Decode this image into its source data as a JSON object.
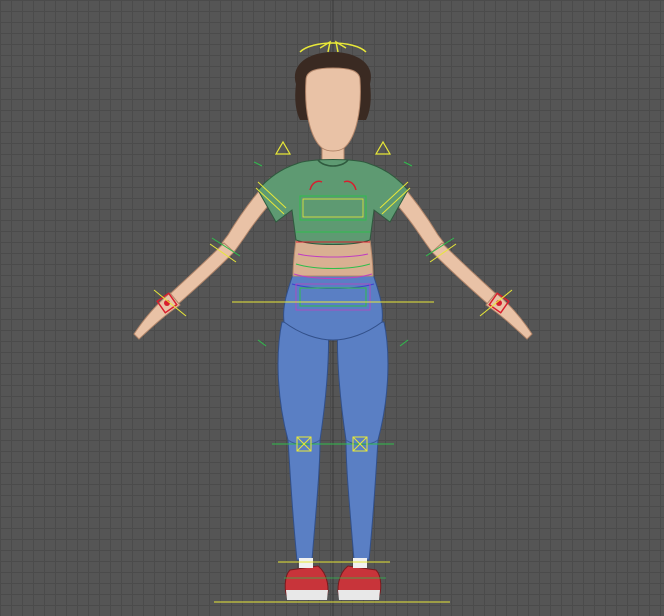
{
  "viewport": {
    "kind": "3d-modeling-viewport",
    "view": "front-orthographic"
  },
  "character": {
    "pose": "A-pose",
    "colors": {
      "skin": "#e9c2a6",
      "skin_shade": "#c9987a",
      "hair": "#3a2a22",
      "shirt": "#5e9a72",
      "shirt_shade": "#3f7354",
      "pants": "#5a7fc4",
      "pants_shade": "#3d5c99",
      "shoes": "#c8343a",
      "shoe_sole": "#e8e8e8"
    }
  },
  "rig": {
    "colors": {
      "yellow": "#e8e838",
      "green": "#2fbd4c",
      "red": "#d81e2e",
      "magenta": "#c040c0",
      "blue": "#4040d0",
      "center_axis": "#3a3a3a"
    },
    "icons": [
      "rotate-arrows-icon",
      "ik-triangle-icon",
      "knee-box-icon"
    ]
  }
}
